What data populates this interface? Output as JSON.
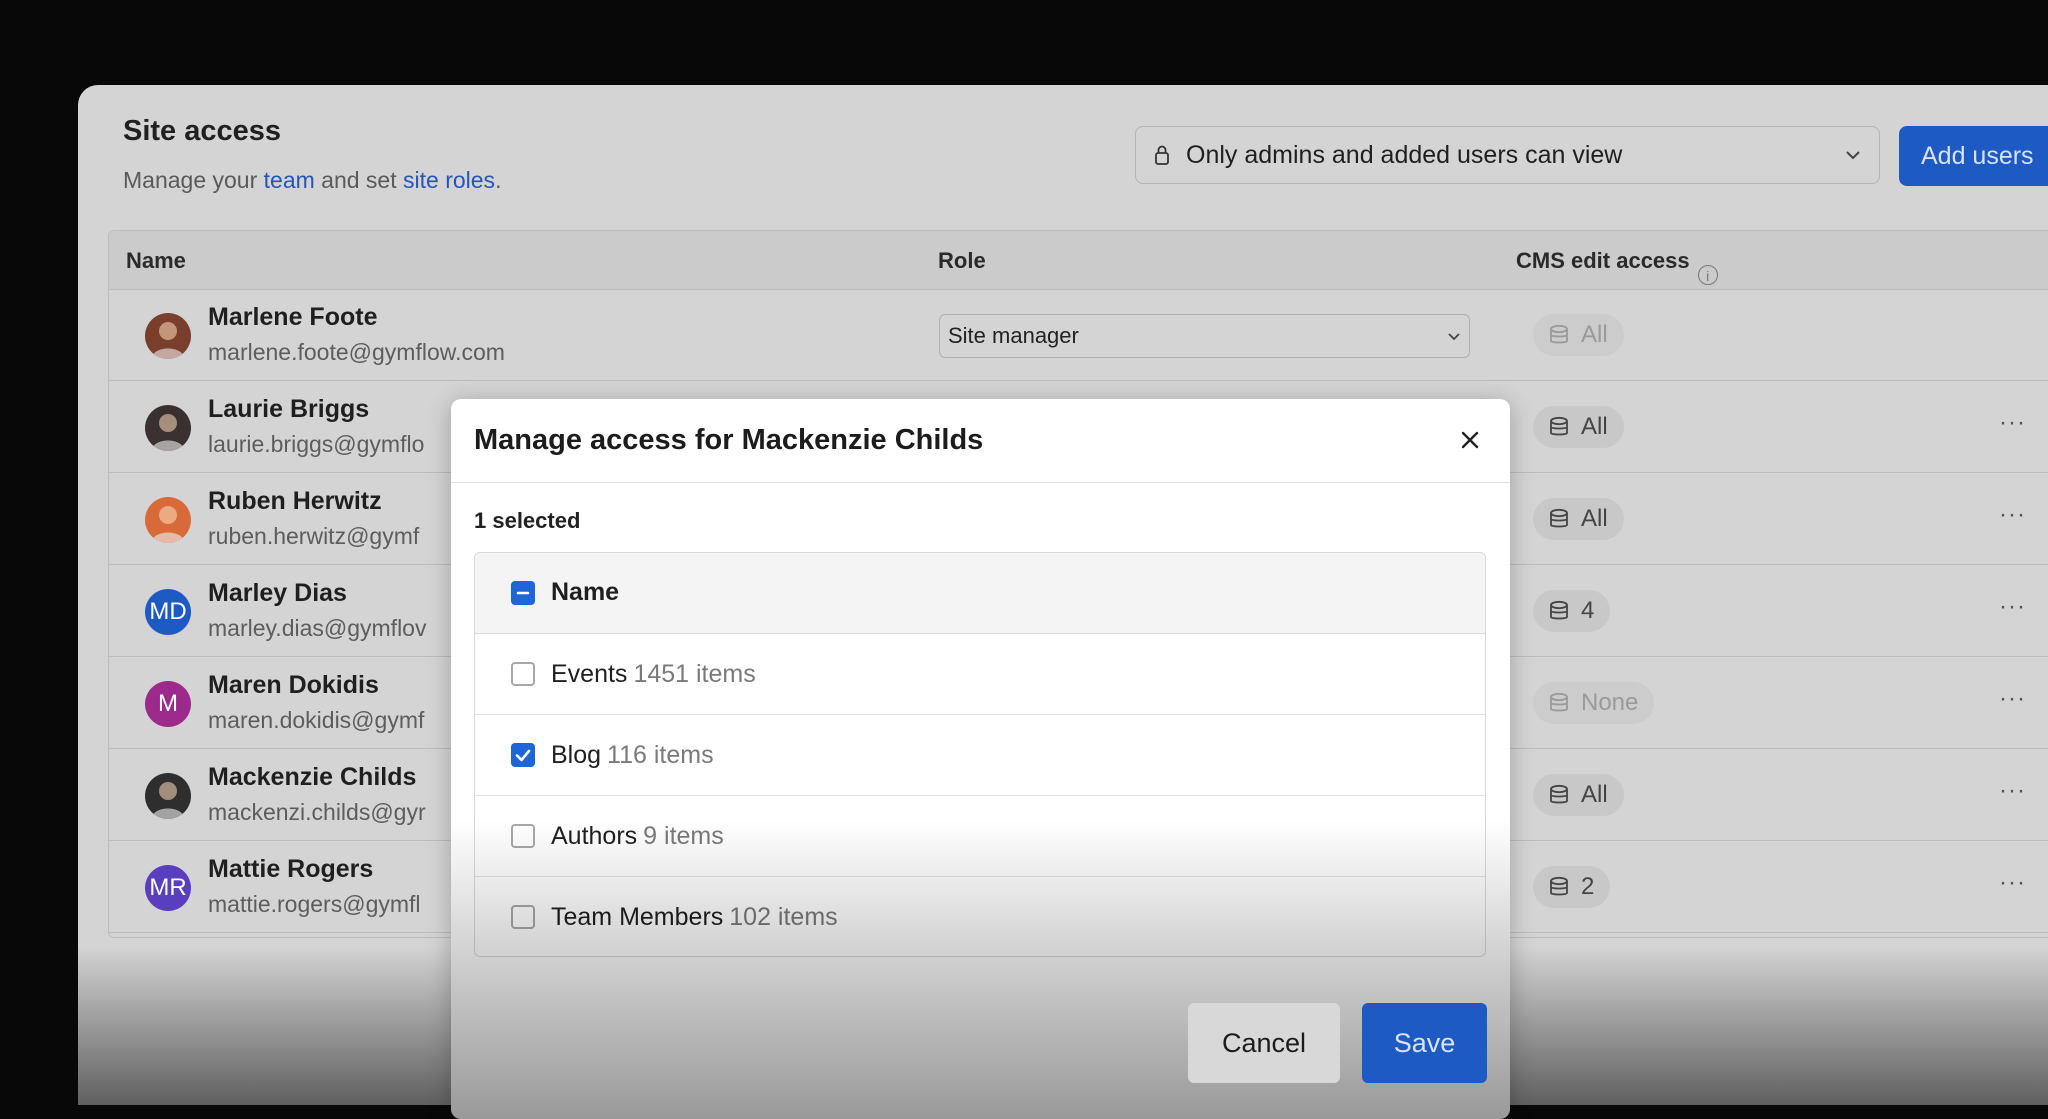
{
  "header": {
    "title": "Site access",
    "subtitle_prefix": "Manage your ",
    "subtitle_link_team": "team",
    "subtitle_mid": " and set ",
    "subtitle_link_roles": "site roles",
    "subtitle_suffix": "."
  },
  "visibility": {
    "icon": "lock-icon",
    "value": "Only admins and added users can view"
  },
  "add_users_label": "Add users",
  "table": {
    "columns": [
      "Name",
      "Role",
      "CMS edit access"
    ],
    "rows": [
      {
        "name": "Marlene Foote",
        "email": "marlene.foote@gymflow.com",
        "avatar": "photo",
        "avatar_color": "#7a3e2c",
        "role": "Site manager",
        "cms": "All",
        "cms_faded": true
      },
      {
        "name": "Laurie Briggs",
        "email": "laurie.briggs@gymflo",
        "avatar": "photo",
        "avatar_color": "#3a3030",
        "role": "",
        "cms": "All",
        "cms_faded": false
      },
      {
        "name": "Ruben Herwitz",
        "email": "ruben.herwitz@gymf",
        "avatar": "photo",
        "avatar_color": "#d86a3a",
        "role": "",
        "cms": "All",
        "cms_faded": false
      },
      {
        "name": "Marley Dias",
        "email": "marley.dias@gymflov",
        "avatar": "MD",
        "avatar_color": "#1e5ac4",
        "role": "",
        "cms": "4",
        "cms_faded": false
      },
      {
        "name": "Maren Dokidis",
        "email": "maren.dokidis@gymf",
        "avatar": "M",
        "avatar_color": "#9c2a8c",
        "role": "",
        "cms": "None",
        "cms_faded": true
      },
      {
        "name": "Mackenzie Childs",
        "email": "mackenzi.childs@gyr",
        "avatar": "photo",
        "avatar_color": "#2e2e2e",
        "role": "",
        "cms": "All",
        "cms_faded": false
      },
      {
        "name": "Mattie Rogers",
        "email": "mattie.rogers@gymfl",
        "avatar": "MR",
        "avatar_color": "#5a3ec0",
        "role": "",
        "cms": "2",
        "cms_faded": false
      }
    ]
  },
  "modal": {
    "title": "Manage access for Mackenzie Childs",
    "selected_count": "1 selected",
    "list_header": "Name",
    "items": [
      {
        "name": "Events",
        "count": "1451 items",
        "checked": false
      },
      {
        "name": "Blog",
        "count": "116 items",
        "checked": true
      },
      {
        "name": "Authors",
        "count": "9 items",
        "checked": false
      },
      {
        "name": "Team Members",
        "count": "102 items",
        "checked": false
      }
    ],
    "cancel_label": "Cancel",
    "save_label": "Save"
  },
  "colors": {
    "accent": "#1e5ac4",
    "checkbox": "#1e66d8",
    "link": "#2656b8"
  }
}
